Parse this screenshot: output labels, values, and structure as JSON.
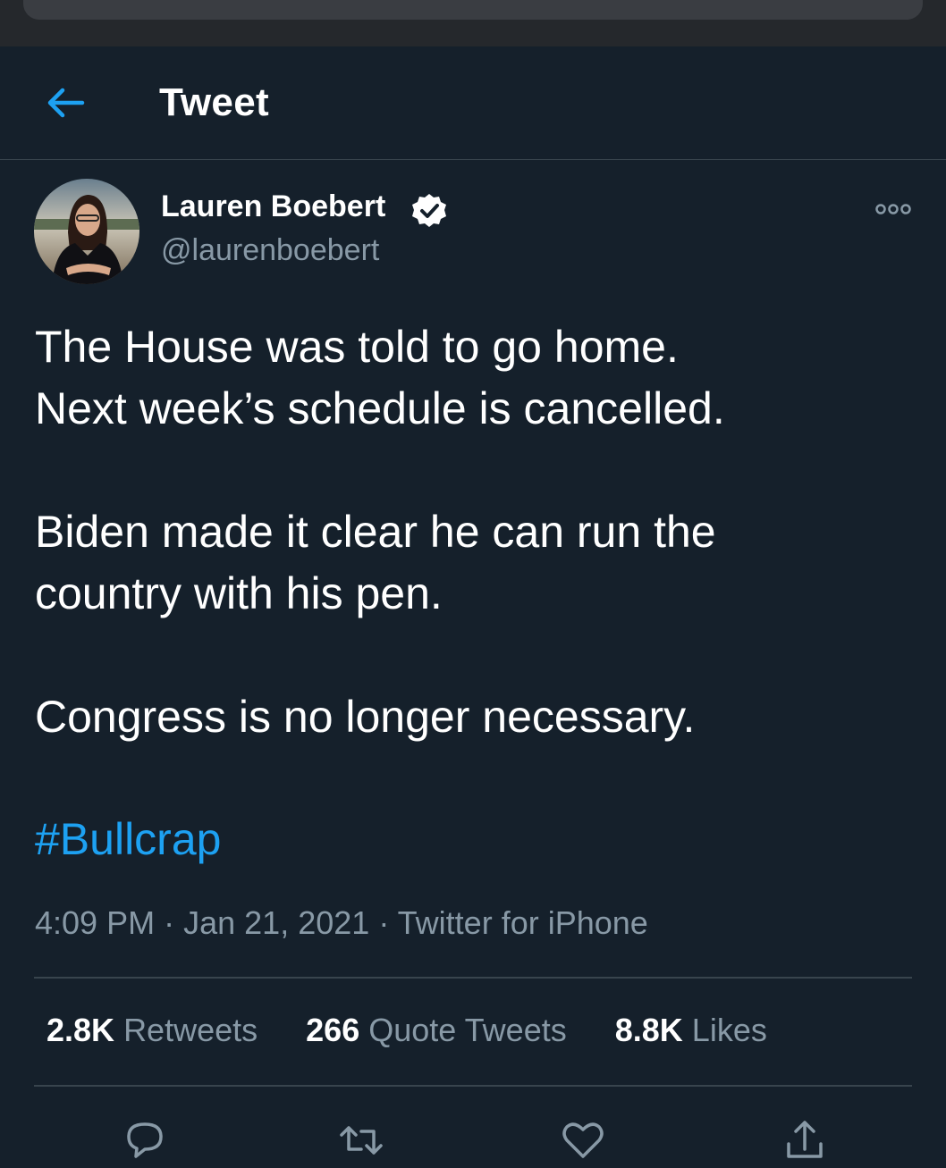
{
  "header": {
    "title": "Tweet"
  },
  "author": {
    "display_name": "Lauren Boebert",
    "handle": "@laurenboebert",
    "verified": true
  },
  "tweet": {
    "paragraphs": [
      [
        "The House was told to go home.",
        "Next week’s schedule is cancelled."
      ],
      [
        "Biden made it clear he can run the",
        "country with his pen."
      ],
      [
        "Congress is no longer necessary."
      ]
    ],
    "hashtag": "#Bullcrap"
  },
  "meta": {
    "time": "4:09 PM",
    "separator": "·",
    "date": "Jan 21, 2021",
    "source": "Twitter for iPhone"
  },
  "stats": {
    "retweets_count": "2.8K",
    "retweets_label": "Retweets",
    "quotes_count": "266",
    "quotes_label": "Quote Tweets",
    "likes_count": "8.8K",
    "likes_label": "Likes"
  },
  "icons": {
    "back": "arrow-left-icon",
    "verified": "verified-badge-icon",
    "more": "more-icon",
    "reply": "reply-icon",
    "retweet": "retweet-icon",
    "like": "like-icon",
    "share": "share-icon"
  },
  "colors": {
    "background": "#15202b",
    "accent": "#1da1f2",
    "secondary_text": "#8899a6",
    "divider": "#38444d"
  }
}
